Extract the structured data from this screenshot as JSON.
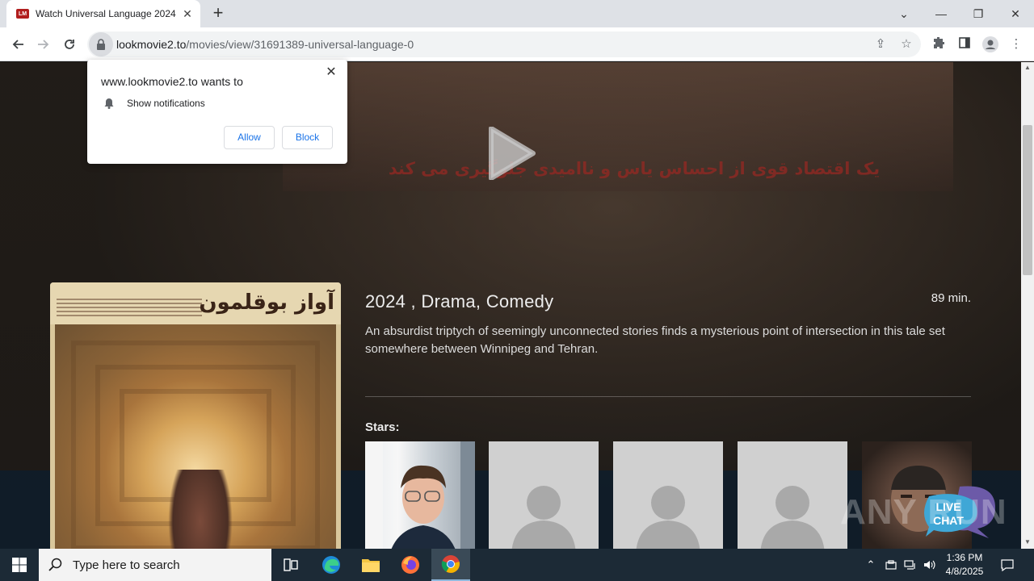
{
  "browser": {
    "tab_title": "Watch Universal Language 2024",
    "tab_favicon_text": "LM",
    "url_host": "lookmovie2.to",
    "url_path": "/movies/view/31691389-universal-language-0"
  },
  "popup": {
    "title": "www.lookmovie2.to wants to",
    "permission": "Show notifications",
    "allow_label": "Allow",
    "block_label": "Block"
  },
  "page": {
    "banner_text": "یک اقتصاد قوی از احساس یاس و ناامیدی جلوگیری می کند",
    "poster_title": "آواز بوقلمون",
    "meta": "2024 , Drama, Comedy",
    "runtime": "89 min.",
    "synopsis": "An absurdist triptych of seemingly unconnected stories finds a mysterious point of intersection in this tale set somewhere between Winnipeg and Tehran.",
    "stars_label": "Stars:",
    "livechat_line1": "LIVE",
    "livechat_line2": "CHAT",
    "watermark": "ANY RUN"
  },
  "taskbar": {
    "search_placeholder": "Type here to search",
    "time": "1:36 PM",
    "date": "4/8/2025"
  },
  "colors": {
    "accent_blue": "#1a73e8",
    "taskbar": "#1c2a36",
    "poster_bg": "#d9c79c"
  }
}
